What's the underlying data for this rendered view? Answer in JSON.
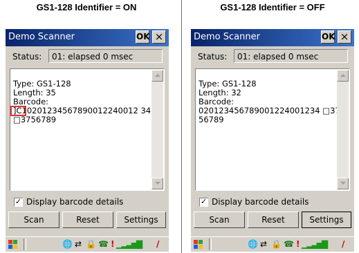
{
  "headings": {
    "left": "GS1-128 Identifier = ON",
    "right": "GS1-128 Identifier = OFF"
  },
  "left": {
    "window_title": "Demo Scanner",
    "ok_label": "OK",
    "close_label": "×",
    "status_label": "Status:",
    "status_value": "01: elapsed 0 msec",
    "lines": [
      "Type: GS1-128",
      "Length: 35",
      "Barcode:",
      "]C1 0201234567890012240012 34",
      "□3756789"
    ],
    "barcode_prefix": "]C1",
    "barcode_line1": "02012345678900122400123 4",
    "barcode_line2": "□3756789",
    "checkbox_label": "Display barcode details",
    "checkbox_checked": true,
    "buttons": {
      "scan": "Scan",
      "reset": "Reset",
      "settings": "Settings"
    }
  },
  "right": {
    "window_title": "Demo Scanner",
    "ok_label": "OK",
    "close_label": "×",
    "status_label": "Status:",
    "status_value": "01: elapsed 0 msec",
    "type_line": "Type: GS1-128",
    "length_line": "Length: 32",
    "barcode_label": "Barcode:",
    "barcode_line1": "020123456789001224001234 □37",
    "barcode_line2": "56789",
    "checkbox_label": "Display barcode details",
    "checkbox_checked": true,
    "buttons": {
      "scan": "Scan",
      "reset": "Reset",
      "settings": "Settings"
    }
  },
  "colors": {
    "titlebar": "#0a246a",
    "highlight": "#e03030",
    "face": "#d4d0c8"
  },
  "taskbar_icons": [
    "windows-start-icon",
    "network-icon",
    "sync-icon",
    "lock-icon",
    "phone-icon",
    "alert-icon",
    "signal-bars-icon",
    "battery-icon",
    "pen-icon"
  ]
}
